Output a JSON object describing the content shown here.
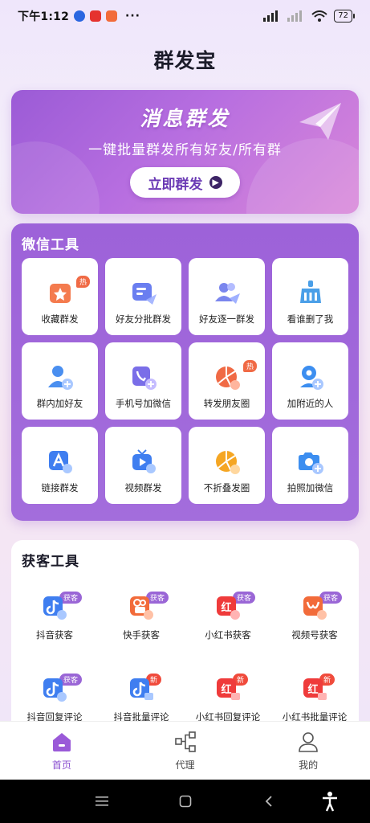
{
  "status": {
    "time": "下午1:12",
    "dots": "···",
    "battery": "72"
  },
  "app": {
    "title": "群发宝"
  },
  "hero": {
    "title": "消息群发",
    "subtitle": "一键批量群发所有好友/所有群",
    "button": "立即群发"
  },
  "wechat_tools": {
    "title": "微信工具",
    "items": [
      {
        "label": "收藏群发",
        "icon": "star-bag-icon",
        "badge": "热"
      },
      {
        "label": "好友分批群发",
        "icon": "batch-send-icon"
      },
      {
        "label": "好友逐一群发",
        "icon": "users-send-icon"
      },
      {
        "label": "看谁删了我",
        "icon": "broom-icon"
      },
      {
        "label": "群内加好友",
        "icon": "add-user-icon"
      },
      {
        "label": "手机号加微信",
        "icon": "phone-add-icon"
      },
      {
        "label": "转发朋友圈",
        "icon": "moments-forward-icon",
        "badge": "热"
      },
      {
        "label": "加附近的人",
        "icon": "nearby-user-icon"
      },
      {
        "label": "链接群发",
        "icon": "link-a-icon"
      },
      {
        "label": "视频群发",
        "icon": "video-play-icon"
      },
      {
        "label": "不折叠发圈",
        "icon": "aperture-icon"
      },
      {
        "label": "拍照加微信",
        "icon": "camera-add-icon"
      }
    ]
  },
  "acquire_tools": {
    "title": "获客工具",
    "items": [
      {
        "label": "抖音获客",
        "icon": "douyin-icon",
        "tag": "获客",
        "tag_color": "purple"
      },
      {
        "label": "快手获客",
        "icon": "kuaishou-icon",
        "tag": "获客",
        "tag_color": "purple"
      },
      {
        "label": "小红书获客",
        "icon": "xiaohongshu-icon",
        "tag": "获客",
        "tag_color": "purple"
      },
      {
        "label": "视频号获客",
        "icon": "channels-icon",
        "tag": "获客",
        "tag_color": "purple"
      },
      {
        "label": "抖音回复评论",
        "icon": "douyin-reply-icon",
        "tag": "获客",
        "tag_color": "purple"
      },
      {
        "label": "抖音批量评论",
        "icon": "douyin-batch-icon",
        "tag": "新",
        "tag_color": "red"
      },
      {
        "label": "小红书回复评论",
        "icon": "xhs-reply-icon",
        "tag": "新",
        "tag_color": "red"
      },
      {
        "label": "小红书批量评论",
        "icon": "xhs-batch-icon",
        "tag": "新",
        "tag_color": "red"
      }
    ]
  },
  "tabs": [
    {
      "label": "首页",
      "icon": "home-icon",
      "active": true
    },
    {
      "label": "代理",
      "icon": "network-icon",
      "active": false
    },
    {
      "label": "我的",
      "icon": "profile-icon",
      "active": false
    }
  ],
  "colors": {
    "accent": "#8a4fd0",
    "hero_start": "#9b5bd6",
    "hero_end": "#d987d9",
    "hot": "#f06a45",
    "new": "#f04b3c"
  }
}
